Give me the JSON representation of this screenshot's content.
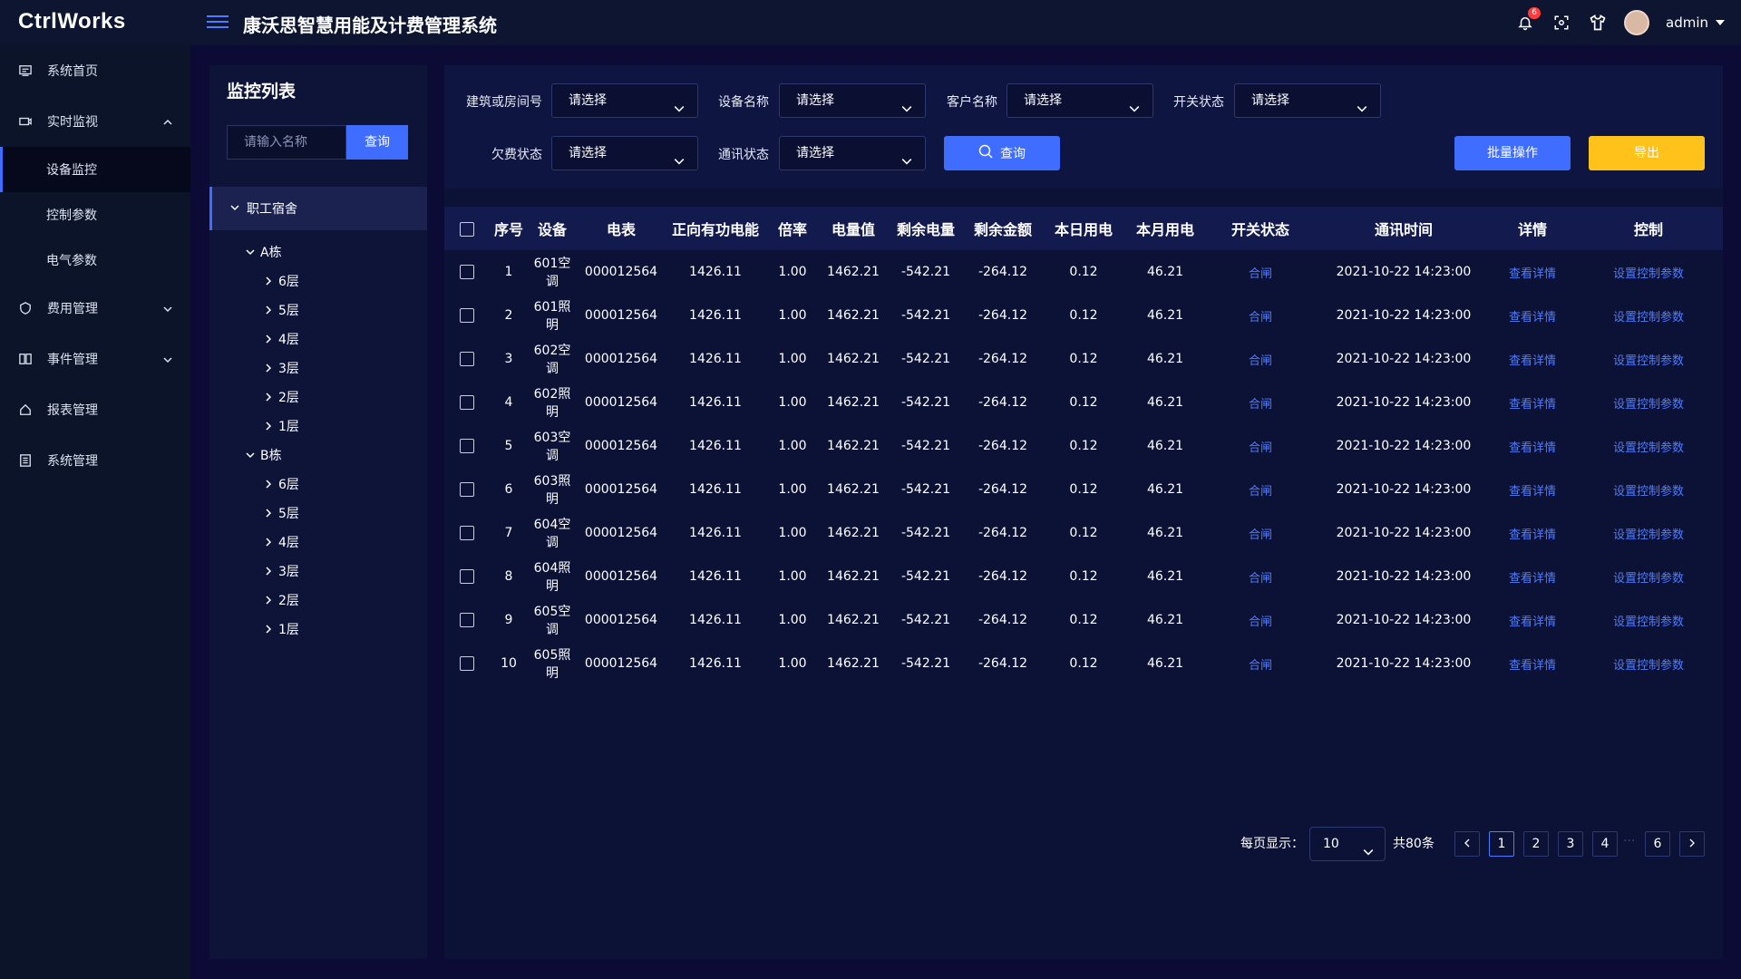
{
  "app": {
    "logo": "CtrlWorks",
    "title": "康沃思智慧用能及计费管理系统",
    "user": "admin",
    "notification_count": "6"
  },
  "sidebar": {
    "items": [
      {
        "label": "系统首页"
      },
      {
        "label": "实时监视"
      },
      {
        "label": "费用管理"
      },
      {
        "label": "事件管理"
      },
      {
        "label": "报表管理"
      },
      {
        "label": "系统管理"
      }
    ],
    "sub_items": [
      {
        "label": "设备监控"
      },
      {
        "label": "控制参数"
      },
      {
        "label": "电气参数"
      }
    ]
  },
  "tree": {
    "title": "监控列表",
    "search_placeholder": "请输入名称",
    "search_button": "查询",
    "root": "职工宿舍",
    "buildings": [
      {
        "name": "A栋",
        "floors": [
          "6层",
          "5层",
          "4层",
          "3层",
          "2层",
          "1层"
        ]
      },
      {
        "name": "B栋",
        "floors": [
          "6层",
          "5层",
          "4层",
          "3层",
          "2层",
          "1层"
        ]
      }
    ]
  },
  "filters": {
    "building_label": "建筑或房间号",
    "device_label": "设备名称",
    "customer_label": "客户名称",
    "switch_label": "开关状态",
    "arrears_label": "欠费状态",
    "comm_label": "通讯状态",
    "placeholder": "请选择",
    "search": "查询",
    "batch": "批量操作",
    "export": "导出"
  },
  "table": {
    "headers": [
      "序号",
      "设备",
      "电表",
      "正向有功电能",
      "倍率",
      "电量值",
      "剩余电量",
      "剩余金额",
      "本日用电",
      "本月用电",
      "开关状态",
      "通讯时间",
      "详情",
      "控制"
    ],
    "rows": [
      [
        "1",
        "601空调",
        "000012564",
        "1426.11",
        "1.00",
        "1462.21",
        "-542.21",
        "-264.12",
        "0.12",
        "46.21",
        "合闸",
        "2021-10-22 14:23:00",
        "查看详情",
        "设置控制参数"
      ],
      [
        "2",
        "601照明",
        "000012564",
        "1426.11",
        "1.00",
        "1462.21",
        "-542.21",
        "-264.12",
        "0.12",
        "46.21",
        "合闸",
        "2021-10-22 14:23:00",
        "查看详情",
        "设置控制参数"
      ],
      [
        "3",
        "602空调",
        "000012564",
        "1426.11",
        "1.00",
        "1462.21",
        "-542.21",
        "-264.12",
        "0.12",
        "46.21",
        "合闸",
        "2021-10-22 14:23:00",
        "查看详情",
        "设置控制参数"
      ],
      [
        "4",
        "602照明",
        "000012564",
        "1426.11",
        "1.00",
        "1462.21",
        "-542.21",
        "-264.12",
        "0.12",
        "46.21",
        "合闸",
        "2021-10-22 14:23:00",
        "查看详情",
        "设置控制参数"
      ],
      [
        "5",
        "603空调",
        "000012564",
        "1426.11",
        "1.00",
        "1462.21",
        "-542.21",
        "-264.12",
        "0.12",
        "46.21",
        "合闸",
        "2021-10-22 14:23:00",
        "查看详情",
        "设置控制参数"
      ],
      [
        "6",
        "603照明",
        "000012564",
        "1426.11",
        "1.00",
        "1462.21",
        "-542.21",
        "-264.12",
        "0.12",
        "46.21",
        "合闸",
        "2021-10-22 14:23:00",
        "查看详情",
        "设置控制参数"
      ],
      [
        "7",
        "604空调",
        "000012564",
        "1426.11",
        "1.00",
        "1462.21",
        "-542.21",
        "-264.12",
        "0.12",
        "46.21",
        "合闸",
        "2021-10-22 14:23:00",
        "查看详情",
        "设置控制参数"
      ],
      [
        "8",
        "604照明",
        "000012564",
        "1426.11",
        "1.00",
        "1462.21",
        "-542.21",
        "-264.12",
        "0.12",
        "46.21",
        "合闸",
        "2021-10-22 14:23:00",
        "查看详情",
        "设置控制参数"
      ],
      [
        "9",
        "605空调",
        "000012564",
        "1426.11",
        "1.00",
        "1462.21",
        "-542.21",
        "-264.12",
        "0.12",
        "46.21",
        "合闸",
        "2021-10-22 14:23:00",
        "查看详情",
        "设置控制参数"
      ],
      [
        "10",
        "605照明",
        "000012564",
        "1426.11",
        "1.00",
        "1462.21",
        "-542.21",
        "-264.12",
        "0.12",
        "46.21",
        "合闸",
        "2021-10-22 14:23:00",
        "查看详情",
        "设置控制参数"
      ]
    ]
  },
  "pagination": {
    "per_page_label": "每页显示：",
    "per_page": "10",
    "total": "共80条",
    "pages": [
      "1",
      "2",
      "3",
      "4",
      "6"
    ],
    "ellipsis": "···",
    "current": "1"
  },
  "colors": {
    "accent": "#3e6dff",
    "export": "#ffc21a",
    "link": "#4f7cff",
    "background": "#0b0b35"
  }
}
